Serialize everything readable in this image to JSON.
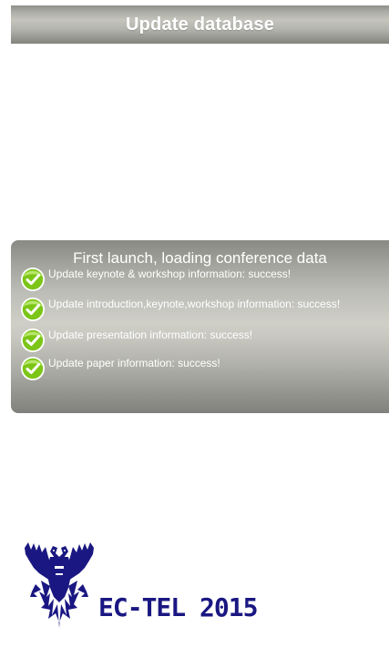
{
  "header": {
    "title": "Update database"
  },
  "status_panel": {
    "heading": "First launch, loading conference data",
    "items": [
      {
        "text": "Update keynote & workshop information: success!",
        "icon": "check-circle-icon"
      },
      {
        "text": "Update introduction,keynote,workshop information: success!",
        "icon": "check-circle-icon"
      },
      {
        "text": "Update presentation information: success!",
        "icon": "check-circle-icon"
      },
      {
        "text": "Update paper information: success!",
        "icon": "check-circle-icon"
      }
    ]
  },
  "logo": {
    "text": "EC-TEL 2015",
    "icon": "double-eagle-icon"
  },
  "colors": {
    "header_gray": "#b4b4ae",
    "panel_gray": "#c8c8c1",
    "check_green": "#7cc517",
    "logo_blue": "#1a1782"
  }
}
